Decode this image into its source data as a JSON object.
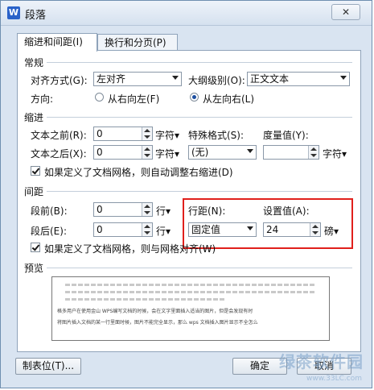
{
  "title": "段落",
  "app_icon_letter": "W",
  "close_symbol": "✕",
  "tabs": [
    {
      "label": "缩进和间距(I)"
    },
    {
      "label": "换行和分页(P)"
    }
  ],
  "general": {
    "section": "常规",
    "align_label": "对齐方式(G):",
    "align_value": "左对齐",
    "outline_label": "大纲级别(O):",
    "outline_value": "正文文本",
    "direction_label": "方向:",
    "rtl_label": "从右向左(F)",
    "ltr_label": "从左向右(L)",
    "direction_selected": "ltr"
  },
  "indent": {
    "section": "缩进",
    "before_label": "文本之前(R):",
    "before_value": "0",
    "before_unit": "字符",
    "after_label": "文本之后(X):",
    "after_value": "0",
    "after_unit": "字符",
    "special_label": "特殊格式(S):",
    "special_value": "(无)",
    "measure_label": "度量值(Y):",
    "measure_value": "",
    "measure_unit": "字符",
    "grid_check_label": "如果定义了文档网格，则自动调整右缩进(D)",
    "grid_checked": true
  },
  "spacing": {
    "section": "间距",
    "before_label": "段前(B):",
    "before_value": "0",
    "before_unit": "行",
    "after_label": "段后(E):",
    "after_value": "0",
    "after_unit": "行",
    "line_label": "行距(N):",
    "line_value": "固定值",
    "setting_label": "设置值(A):",
    "setting_value": "24",
    "setting_unit": "磅",
    "grid_check_label": "如果定义了文档网格，则与网格对齐(W)",
    "grid_checked": true
  },
  "preview": {
    "section": "预览",
    "sample_line_1": "格多用户在使用金山 WPS编写文档的时候，会在文字里面插入适当的图片，但是会发现有时",
    "sample_line_2": "将图片插入文档的某一行里面时候，图片不能完全显示，那么 wps 文档插入图片显示不全怎么"
  },
  "buttons": {
    "tabs_label": "制表位(T)...",
    "ok_label": "确定",
    "cancel_label": "取消"
  },
  "watermark": {
    "text": "绿茶软件园",
    "url": "www.33LC.com"
  },
  "colors": {
    "highlight": "#e0201c",
    "accent": "#1d4fa0"
  }
}
